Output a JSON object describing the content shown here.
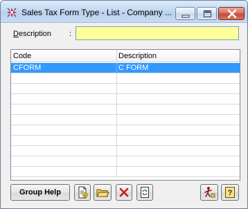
{
  "window": {
    "title": "Sales Tax Form Type - List - Company ..."
  },
  "filter": {
    "label": "Description",
    "colon": ":",
    "value": ""
  },
  "grid": {
    "columns": [
      "Code",
      "Description"
    ],
    "rows": [
      {
        "code": "CFORM",
        "description": "C FORM",
        "selected": true
      }
    ],
    "empty_rows": 10
  },
  "toolbar": {
    "group_help_label": "Group Help",
    "icons": [
      "new-record-icon",
      "open-folder-icon",
      "delete-icon",
      "refresh-icon",
      "exit-icon",
      "help-icon"
    ]
  },
  "colors": {
    "filter_field_bg": "#ffff99",
    "selection": "#3399ff",
    "close_button": "#c44a35"
  }
}
